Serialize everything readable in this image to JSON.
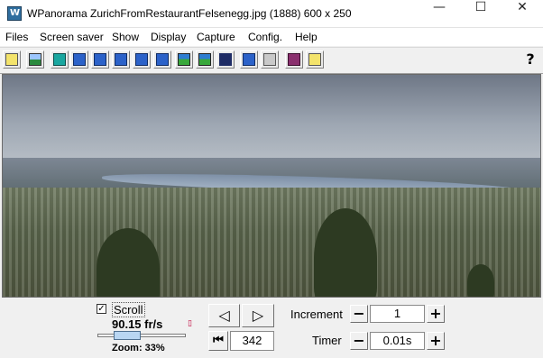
{
  "window": {
    "title": "WPanorama  ZurichFromRestaurantFelsenegg.jpg   (1888) 600 x 250",
    "minimize_glyph": "—",
    "maximize_glyph": "☐",
    "close_glyph": "✕"
  },
  "menu": {
    "items": [
      {
        "label": "Files"
      },
      {
        "label": "Screen saver"
      },
      {
        "label": "Show"
      },
      {
        "label": "Display"
      },
      {
        "label": "Capture"
      },
      {
        "label": "Config."
      },
      {
        "label": "Help"
      }
    ]
  },
  "toolbar": {
    "buttons": [
      {
        "icon": "open-folder-icon"
      },
      {
        "icon": "image-icon"
      },
      {
        "icon": "fit-icon"
      },
      {
        "icon": "expand-icon"
      },
      {
        "icon": "arrow-up-left-icon"
      },
      {
        "icon": "arrow-up-right-icon"
      },
      {
        "icon": "arrow-down-left-icon"
      },
      {
        "icon": "arrow-down-right-icon"
      },
      {
        "icon": "panorama-icon"
      },
      {
        "icon": "landscape-icon"
      },
      {
        "icon": "strip-icon"
      },
      {
        "icon": "level-icon"
      },
      {
        "icon": "speaker-icon"
      },
      {
        "icon": "book-icon"
      },
      {
        "icon": "help-tip-icon"
      }
    ],
    "help_label": "?"
  },
  "controls": {
    "scroll_checked": true,
    "scroll_label": "Scroll",
    "fps": "90.15 fr/s",
    "zoom_label": "Zoom: 33%",
    "zoom_fraction": 0.33,
    "prev_glyph": "◁",
    "next_glyph": "▷",
    "first_glyph": "⏮",
    "frame_value": "342",
    "increment_label": "Increment",
    "increment_value": "1",
    "timer_label": "Timer",
    "timer_value": "0.01s",
    "minus_glyph": "−",
    "plus_glyph": "+"
  }
}
